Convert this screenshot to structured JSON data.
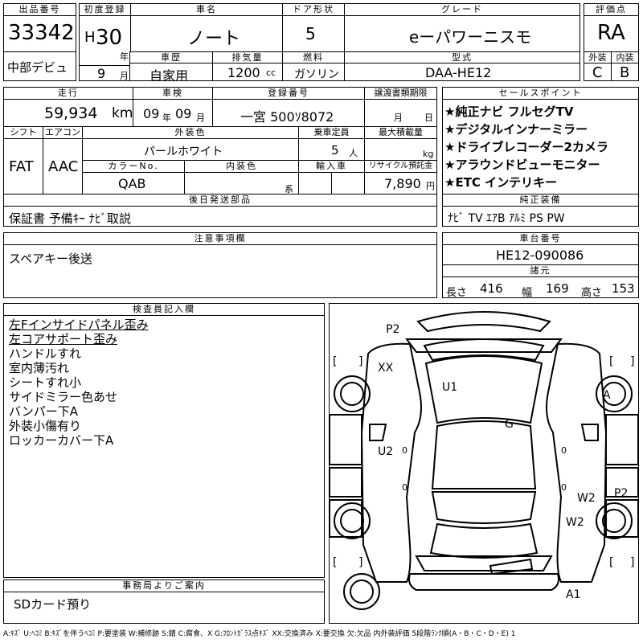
{
  "header": {
    "lot_label": "出品番号",
    "lot_value": "33342",
    "first_reg_label": "初度登録",
    "era": "H",
    "year": "30",
    "year_suffix": "年",
    "month": "9",
    "month_suffix": "月",
    "name_label": "車名",
    "name_value": "ノート",
    "door_label": "ドア形状",
    "door_value": "5",
    "grade_label": "グレード",
    "grade_value": "eーパワーニスモ",
    "score_label": "評価点",
    "score_value": "RA",
    "region": "中部デビュ",
    "history_label": "車歴",
    "history_value": "自家用",
    "disp_label": "排気量",
    "disp_value": "1200",
    "disp_unit": "cc",
    "fuel_label": "燃料",
    "fuel_value": "ガソリン",
    "model_label": "型式",
    "model_value": "DAA-HE12",
    "ext_label": "外装",
    "ext_value": "C",
    "int_label": "内装",
    "int_value": "B"
  },
  "row2": {
    "mileage_label": "走行",
    "mileage_value": "59,934",
    "mileage_unit": "km",
    "inspection_label": "車検",
    "insp_year": "09",
    "insp_year_suffix": "年",
    "insp_month": "09",
    "insp_month_suffix": "月",
    "plate_label": "登録番号",
    "plate_value": "一宮 500ｿ8072",
    "transfer_label": "譲渡書類期限",
    "transfer_month": "月",
    "transfer_day": "日",
    "shift_label": "シフト",
    "shift_value": "FAT",
    "ac_label": "エアコン",
    "ac_value": "AAC",
    "color_label": "外装色",
    "color_value": "パールホワイト",
    "capacity_label": "乗車定員",
    "capacity_value": "5",
    "capacity_unit": "人",
    "load_label": "最大積載量",
    "load_unit": "kg",
    "color_no_label": "カラーNo.",
    "color_no_value": "QAB",
    "interior_label": "内装色",
    "interior_unit": "系",
    "import_label": "輸入車",
    "recycle_label": "リサイクル預託金",
    "recycle_value": "7,890",
    "recycle_unit": "円",
    "later_label": "後日発送部品",
    "later_value": "保証書 予備ｷｰ ﾅﾋﾞ取説"
  },
  "sales": {
    "label": "セールスポイント",
    "items": [
      "★純正ナビ フルセグTV",
      "★デジタルインナーミラー",
      "★ドライブレコーダー2カメラ",
      "★アラウンドビューモニター",
      "★ETC インテリキー"
    ],
    "equip_label": "純正装備",
    "equip_value": "ﾅﾋﾞ TV ｴｱB ｱﾙﾐ PS PW"
  },
  "caution": {
    "label": "注意事項欄",
    "value": "スペアキー後送"
  },
  "chassis": {
    "label": "車台番号",
    "value": "HE12-090086",
    "dims_label": "諸元",
    "len_label": "長さ",
    "len_value": "416",
    "wid_label": "幅",
    "wid_value": "169",
    "hgt_label": "高さ",
    "hgt_value": "153"
  },
  "inspector": {
    "label": "検査員記入欄",
    "items": [
      "左Fインサイドパネル歪み",
      "左コアサポート歪み",
      "ハンドルすれ",
      "室内薄汚れ",
      "シートすれ小",
      "サイドミラー色あせ",
      "バンパー下A",
      "外装小傷有り",
      "ロッカーカバー下A"
    ]
  },
  "office": {
    "label": "事務局よりご案内",
    "value": "SDカード預り"
  },
  "diagram": {
    "marks": [
      "P2",
      "XX",
      "U1",
      "A",
      "G",
      "U2",
      "W2",
      "P2",
      "W2",
      "A1"
    ],
    "brackets": [
      "[",
      "]",
      "[",
      "]",
      "[",
      "]",
      "[",
      "]"
    ],
    "zeros": [
      "0",
      "0",
      "0",
      "0"
    ]
  },
  "footer": "A:ｷｽﾞ U:ﾍｺﾐ B:ｷｽﾞを伴うﾍｺﾐ P:要塗装 W:補修跡 S:錆 C:腐食、X G:ﾌﾛﾝﾄｶﾞﾗｽ点ｷｽﾞ XX:交換済み X:要交換 欠:欠品 内外装評価 5段階ﾗﾝｸ順(A・B・C・D・E) 1"
}
